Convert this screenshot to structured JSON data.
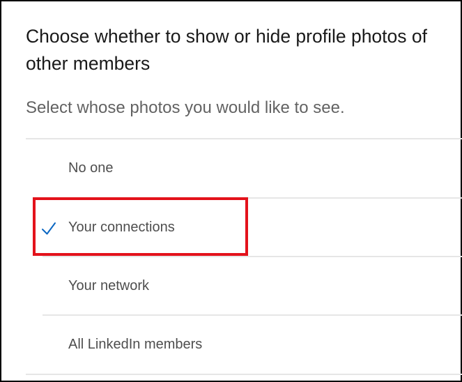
{
  "header": {
    "title": "Choose whether to show or hide profile photos of other members",
    "subtitle": "Select whose photos you would like to see."
  },
  "options": [
    {
      "label": "No one",
      "selected": false
    },
    {
      "label": "Your connections",
      "selected": true
    },
    {
      "label": "Your network",
      "selected": false
    },
    {
      "label": "All LinkedIn members",
      "selected": false
    }
  ],
  "colors": {
    "check": "#0a66c2",
    "highlight_box": "#e3121b"
  },
  "icons": {
    "selected_indicator": "checkmark-icon"
  }
}
